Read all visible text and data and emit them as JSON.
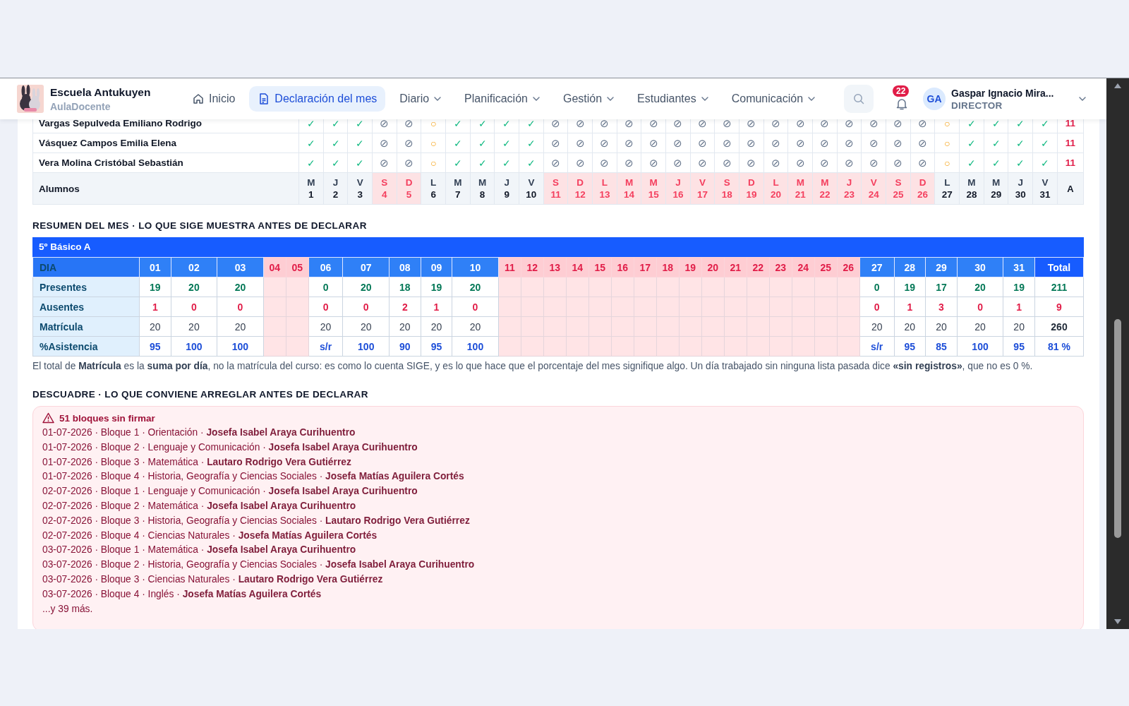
{
  "header": {
    "school": "Escuela Antukuyen",
    "app": "AulaDocente",
    "nav": [
      {
        "label": "Inicio",
        "kind": "home",
        "selected": false
      },
      {
        "label": "Declaración del mes",
        "kind": "doc",
        "selected": true
      },
      {
        "label": "Diario",
        "kind": "menu",
        "selected": false
      },
      {
        "label": "Planificación",
        "kind": "menu",
        "selected": false
      },
      {
        "label": "Gestión",
        "kind": "menu",
        "selected": false
      },
      {
        "label": "Estudiantes",
        "kind": "menu",
        "selected": false
      },
      {
        "label": "Comunicación",
        "kind": "menu",
        "selected": false
      }
    ],
    "notifications": "22",
    "user": {
      "initials": "GA",
      "name": "Gaspar Ignacio Mira...",
      "role": "DIRECTOR"
    }
  },
  "attendance": {
    "header_label": "Alumnos",
    "total_label": "A",
    "days": [
      {
        "weekday": "M",
        "day": "1",
        "weekend": false
      },
      {
        "weekday": "J",
        "day": "2",
        "weekend": false
      },
      {
        "weekday": "V",
        "day": "3",
        "weekend": false
      },
      {
        "weekday": "S",
        "day": "4",
        "weekend": true
      },
      {
        "weekday": "D",
        "day": "5",
        "weekend": true
      },
      {
        "weekday": "L",
        "day": "6",
        "weekend": false
      },
      {
        "weekday": "M",
        "day": "7",
        "weekend": false
      },
      {
        "weekday": "M",
        "day": "8",
        "weekend": false
      },
      {
        "weekday": "J",
        "day": "9",
        "weekend": false
      },
      {
        "weekday": "V",
        "day": "10",
        "weekend": false
      },
      {
        "weekday": "S",
        "day": "11",
        "weekend": true
      },
      {
        "weekday": "D",
        "day": "12",
        "weekend": true
      },
      {
        "weekday": "L",
        "day": "13",
        "weekend": true
      },
      {
        "weekday": "M",
        "day": "14",
        "weekend": true
      },
      {
        "weekday": "M",
        "day": "15",
        "weekend": true
      },
      {
        "weekday": "J",
        "day": "16",
        "weekend": true
      },
      {
        "weekday": "V",
        "day": "17",
        "weekend": true
      },
      {
        "weekday": "S",
        "day": "18",
        "weekend": true
      },
      {
        "weekday": "D",
        "day": "19",
        "weekend": true
      },
      {
        "weekday": "L",
        "day": "20",
        "weekend": true
      },
      {
        "weekday": "M",
        "day": "21",
        "weekend": true
      },
      {
        "weekday": "M",
        "day": "22",
        "weekend": true
      },
      {
        "weekday": "J",
        "day": "23",
        "weekend": true
      },
      {
        "weekday": "V",
        "day": "24",
        "weekend": true
      },
      {
        "weekday": "S",
        "day": "25",
        "weekend": true
      },
      {
        "weekday": "D",
        "day": "26",
        "weekend": true
      },
      {
        "weekday": "L",
        "day": "27",
        "weekend": false
      },
      {
        "weekday": "M",
        "day": "28",
        "weekend": false
      },
      {
        "weekday": "M",
        "day": "29",
        "weekend": false
      },
      {
        "weekday": "J",
        "day": "30",
        "weekend": false
      },
      {
        "weekday": "V",
        "day": "31",
        "weekend": false
      }
    ],
    "rows": [
      {
        "name": "Vargas Sepulveda Emiliano Rodrigo",
        "total": "11",
        "marks": [
          {
            "mark": "✓",
            "kind": "present"
          },
          {
            "mark": "✓",
            "kind": "present"
          },
          {
            "mark": "✓",
            "kind": "present"
          },
          {
            "mark": "⊘",
            "kind": "none"
          },
          {
            "mark": "⊘",
            "kind": "none"
          },
          {
            "mark": "○",
            "kind": "pending"
          },
          {
            "mark": "✓",
            "kind": "present"
          },
          {
            "mark": "✓",
            "kind": "present"
          },
          {
            "mark": "✓",
            "kind": "present"
          },
          {
            "mark": "✓",
            "kind": "present"
          },
          {
            "mark": "⊘",
            "kind": "none"
          },
          {
            "mark": "⊘",
            "kind": "none"
          },
          {
            "mark": "⊘",
            "kind": "none"
          },
          {
            "mark": "⊘",
            "kind": "none"
          },
          {
            "mark": "⊘",
            "kind": "none"
          },
          {
            "mark": "⊘",
            "kind": "none"
          },
          {
            "mark": "⊘",
            "kind": "none"
          },
          {
            "mark": "⊘",
            "kind": "none"
          },
          {
            "mark": "⊘",
            "kind": "none"
          },
          {
            "mark": "⊘",
            "kind": "none"
          },
          {
            "mark": "⊘",
            "kind": "none"
          },
          {
            "mark": "⊘",
            "kind": "none"
          },
          {
            "mark": "⊘",
            "kind": "none"
          },
          {
            "mark": "⊘",
            "kind": "none"
          },
          {
            "mark": "⊘",
            "kind": "none"
          },
          {
            "mark": "⊘",
            "kind": "none"
          },
          {
            "mark": "○",
            "kind": "pending"
          },
          {
            "mark": "✓",
            "kind": "present"
          },
          {
            "mark": "✓",
            "kind": "present"
          },
          {
            "mark": "✓",
            "kind": "present"
          },
          {
            "mark": "✓",
            "kind": "present"
          }
        ]
      },
      {
        "name": "Vásquez Campos Emilia Elena",
        "total": "11",
        "marks": [
          {
            "mark": "✓",
            "kind": "present"
          },
          {
            "mark": "✓",
            "kind": "present"
          },
          {
            "mark": "✓",
            "kind": "present"
          },
          {
            "mark": "⊘",
            "kind": "none"
          },
          {
            "mark": "⊘",
            "kind": "none"
          },
          {
            "mark": "○",
            "kind": "pending"
          },
          {
            "mark": "✓",
            "kind": "present"
          },
          {
            "mark": "✓",
            "kind": "present"
          },
          {
            "mark": "✓",
            "kind": "present"
          },
          {
            "mark": "✓",
            "kind": "present"
          },
          {
            "mark": "⊘",
            "kind": "none"
          },
          {
            "mark": "⊘",
            "kind": "none"
          },
          {
            "mark": "⊘",
            "kind": "none"
          },
          {
            "mark": "⊘",
            "kind": "none"
          },
          {
            "mark": "⊘",
            "kind": "none"
          },
          {
            "mark": "⊘",
            "kind": "none"
          },
          {
            "mark": "⊘",
            "kind": "none"
          },
          {
            "mark": "⊘",
            "kind": "none"
          },
          {
            "mark": "⊘",
            "kind": "none"
          },
          {
            "mark": "⊘",
            "kind": "none"
          },
          {
            "mark": "⊘",
            "kind": "none"
          },
          {
            "mark": "⊘",
            "kind": "none"
          },
          {
            "mark": "⊘",
            "kind": "none"
          },
          {
            "mark": "⊘",
            "kind": "none"
          },
          {
            "mark": "⊘",
            "kind": "none"
          },
          {
            "mark": "⊘",
            "kind": "none"
          },
          {
            "mark": "○",
            "kind": "pending"
          },
          {
            "mark": "✓",
            "kind": "present"
          },
          {
            "mark": "✓",
            "kind": "present"
          },
          {
            "mark": "✓",
            "kind": "present"
          },
          {
            "mark": "✓",
            "kind": "present"
          }
        ]
      },
      {
        "name": "Vera Molina Cristóbal Sebastián",
        "total": "11",
        "marks": [
          {
            "mark": "✓",
            "kind": "present"
          },
          {
            "mark": "✓",
            "kind": "present"
          },
          {
            "mark": "✓",
            "kind": "present"
          },
          {
            "mark": "⊘",
            "kind": "none"
          },
          {
            "mark": "⊘",
            "kind": "none"
          },
          {
            "mark": "○",
            "kind": "pending"
          },
          {
            "mark": "✓",
            "kind": "present"
          },
          {
            "mark": "✓",
            "kind": "present"
          },
          {
            "mark": "✓",
            "kind": "present"
          },
          {
            "mark": "✓",
            "kind": "present"
          },
          {
            "mark": "⊘",
            "kind": "none"
          },
          {
            "mark": "⊘",
            "kind": "none"
          },
          {
            "mark": "⊘",
            "kind": "none"
          },
          {
            "mark": "⊘",
            "kind": "none"
          },
          {
            "mark": "⊘",
            "kind": "none"
          },
          {
            "mark": "⊘",
            "kind": "none"
          },
          {
            "mark": "⊘",
            "kind": "none"
          },
          {
            "mark": "⊘",
            "kind": "none"
          },
          {
            "mark": "⊘",
            "kind": "none"
          },
          {
            "mark": "⊘",
            "kind": "none"
          },
          {
            "mark": "⊘",
            "kind": "none"
          },
          {
            "mark": "⊘",
            "kind": "none"
          },
          {
            "mark": "⊘",
            "kind": "none"
          },
          {
            "mark": "⊘",
            "kind": "none"
          },
          {
            "mark": "⊘",
            "kind": "none"
          },
          {
            "mark": "⊘",
            "kind": "none"
          },
          {
            "mark": "○",
            "kind": "pending"
          },
          {
            "mark": "✓",
            "kind": "present"
          },
          {
            "mark": "✓",
            "kind": "present"
          },
          {
            "mark": "✓",
            "kind": "present"
          },
          {
            "mark": "✓",
            "kind": "present"
          }
        ]
      }
    ]
  },
  "summary": {
    "heading": "RESUMEN DEL MES · LO QUE SIGE MUESTRA ANTES DE DECLARAR",
    "course": "5º Básico A",
    "corner": "DIA",
    "total_label": "Total",
    "columns": [
      {
        "label": "01",
        "weekend": false
      },
      {
        "label": "02",
        "weekend": false
      },
      {
        "label": "03",
        "weekend": false
      },
      {
        "label": "04",
        "weekend": true
      },
      {
        "label": "05",
        "weekend": true
      },
      {
        "label": "06",
        "weekend": false
      },
      {
        "label": "07",
        "weekend": false
      },
      {
        "label": "08",
        "weekend": false
      },
      {
        "label": "09",
        "weekend": false
      },
      {
        "label": "10",
        "weekend": false
      },
      {
        "label": "11",
        "weekend": true
      },
      {
        "label": "12",
        "weekend": true
      },
      {
        "label": "13",
        "weekend": true
      },
      {
        "label": "14",
        "weekend": true
      },
      {
        "label": "15",
        "weekend": true
      },
      {
        "label": "16",
        "weekend": true
      },
      {
        "label": "17",
        "weekend": true
      },
      {
        "label": "18",
        "weekend": true
      },
      {
        "label": "19",
        "weekend": true
      },
      {
        "label": "20",
        "weekend": true
      },
      {
        "label": "21",
        "weekend": true
      },
      {
        "label": "22",
        "weekend": true
      },
      {
        "label": "23",
        "weekend": true
      },
      {
        "label": "24",
        "weekend": true
      },
      {
        "label": "25",
        "weekend": true
      },
      {
        "label": "26",
        "weekend": true
      },
      {
        "label": "27",
        "weekend": false
      },
      {
        "label": "28",
        "weekend": false
      },
      {
        "label": "29",
        "weekend": false
      },
      {
        "label": "30",
        "weekend": false
      },
      {
        "label": "31",
        "weekend": false
      }
    ],
    "rows": [
      {
        "label": "Presentes",
        "kind": "present",
        "cells": [
          "19",
          "20",
          "20",
          "",
          "",
          "0",
          "20",
          "18",
          "19",
          "20",
          "",
          "",
          "",
          "",
          "",
          "",
          "",
          "",
          "",
          "",
          "",
          "",
          "",
          "",
          "",
          "",
          "0",
          "19",
          "17",
          "20",
          "19"
        ],
        "total": "211"
      },
      {
        "label": "Ausentes",
        "kind": "absent",
        "cells": [
          "1",
          "0",
          "0",
          "",
          "",
          "0",
          "0",
          "2",
          "1",
          "0",
          "",
          "",
          "",
          "",
          "",
          "",
          "",
          "",
          "",
          "",
          "",
          "",
          "",
          "",
          "",
          "",
          "0",
          "1",
          "3",
          "0",
          "1"
        ],
        "total": "9"
      },
      {
        "label": "Matrícula",
        "kind": "enrolled",
        "cells": [
          "20",
          "20",
          "20",
          "",
          "",
          "20",
          "20",
          "20",
          "20",
          "20",
          "",
          "",
          "",
          "",
          "",
          "",
          "",
          "",
          "",
          "",
          "",
          "",
          "",
          "",
          "",
          "",
          "20",
          "20",
          "20",
          "20",
          "20"
        ],
        "total": "260"
      },
      {
        "label": "%Asistencia",
        "kind": "rate",
        "cells": [
          "95",
          "100",
          "100",
          "",
          "",
          "s/r",
          "100",
          "90",
          "95",
          "100",
          "",
          "",
          "",
          "",
          "",
          "",
          "",
          "",
          "",
          "",
          "",
          "",
          "",
          "",
          "",
          "",
          "s/r",
          "95",
          "85",
          "100",
          "95"
        ],
        "total": "81 %"
      }
    ],
    "note": "El total de **Matrícula** es la **suma por día**, no la matrícula del curso: es como lo cuenta SIGE, y es lo que hace que el porcentaje del mes signifique algo. Un día trabajado sin ninguna lista pasada dice **«sin registros»**, que no es 0 %."
  },
  "mismatch": {
    "heading": "DESCUADRE · LO QUE CONVIENE ARREGLAR ANTES DE DECLARAR",
    "alert_title": "51 bloques sin firmar",
    "items": [
      "01-07-2026 · Bloque 1 · Orientación · **Josefa Isabel Araya Curihuentro**",
      "01-07-2026 · Bloque 2 · Lenguaje y Comunicación · **Josefa Isabel Araya Curihuentro**",
      "01-07-2026 · Bloque 3 · Matemática · **Lautaro Rodrigo Vera Gutiérrez**",
      "01-07-2026 · Bloque 4 · Historia, Geografía y Ciencias Sociales · **Josefa Matías Aguilera Cortés**",
      "02-07-2026 · Bloque 1 · Lenguaje y Comunicación · **Josefa Isabel Araya Curihuentro**",
      "02-07-2026 · Bloque 2 · Matemática · **Josefa Isabel Araya Curihuentro**",
      "02-07-2026 · Bloque 3 · Historia, Geografía y Ciencias Sociales · **Lautaro Rodrigo Vera Gutiérrez**",
      "02-07-2026 · Bloque 4 · Ciencias Naturales · **Josefa Matías Aguilera Cortés**",
      "03-07-2026 · Bloque 1 · Matemática · **Josefa Isabel Araya Curihuentro**",
      "03-07-2026 · Bloque 2 · Historia, Geografía y Ciencias Sociales · **Josefa Isabel Araya Curihuentro**",
      "03-07-2026 · Bloque 3 · Ciencias Naturales · **Lautaro Rodrigo Vera Gutiérrez**",
      "03-07-2026 · Bloque 4 · Inglés · **Josefa Matías Aguilera Cortés**"
    ],
    "more": "...y 39 más."
  }
}
